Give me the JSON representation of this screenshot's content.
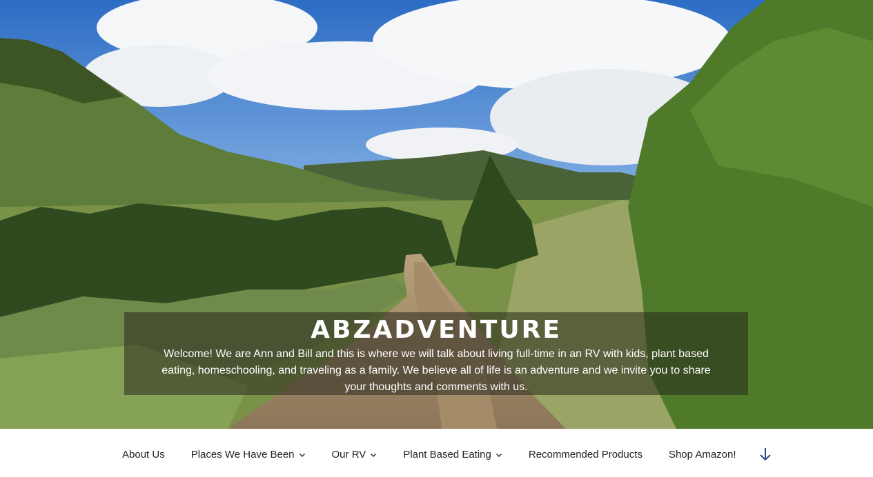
{
  "site": {
    "title": "ABZADVENTURE",
    "description": "Welcome! We are Ann and Bill and this is where we will talk about living full-time in an RV with kids, plant based eating, homeschooling, and traveling as a family. We believe all of life is an adventure and we invite you to share your thoughts and comments with us."
  },
  "nav": {
    "items": [
      {
        "label": "About Us",
        "has_submenu": false
      },
      {
        "label": "Places We Have Been",
        "has_submenu": true
      },
      {
        "label": "Our RV",
        "has_submenu": true
      },
      {
        "label": "Plant Based Eating",
        "has_submenu": true
      },
      {
        "label": "Recommended Products",
        "has_submenu": false
      },
      {
        "label": "Shop Amazon!",
        "has_submenu": false
      }
    ],
    "scroll_icon": "arrow-down-icon"
  },
  "colors": {
    "nav_text": "#222222",
    "scroll_arrow": "#2b4a8f",
    "overlay": "#28281e"
  }
}
